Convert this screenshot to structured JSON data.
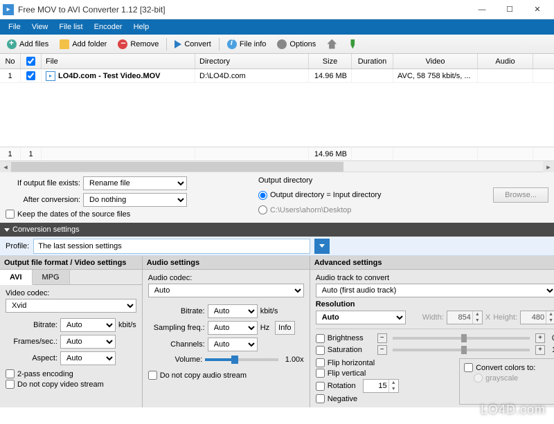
{
  "window": {
    "title": "Free MOV to AVI Converter 1.12  [32-bit]"
  },
  "menu": [
    "File",
    "View",
    "File list",
    "Encoder",
    "Help"
  ],
  "toolbar": {
    "add_files": "Add files",
    "add_folder": "Add folder",
    "remove": "Remove",
    "convert": "Convert",
    "file_info": "File info",
    "options": "Options"
  },
  "grid": {
    "headers": {
      "no": "No",
      "file": "File",
      "dir": "Directory",
      "size": "Size",
      "dur": "Duration",
      "video": "Video",
      "audio": "Audio"
    },
    "rows": [
      {
        "no": "1",
        "checked": true,
        "file": "LO4D.com - Test Video.MOV",
        "dir": "D:\\LO4D.com",
        "size": "14.96 MB",
        "dur": "",
        "video": "AVC, 58 758 kbit/s, ...",
        "audio": ""
      }
    ],
    "footer": {
      "idx": "1",
      "count": "1",
      "total_size": "14.96 MB"
    }
  },
  "output_opts": {
    "if_exists_label": "If output file exists:",
    "if_exists_value": "Rename file",
    "after_label": "After conversion:",
    "after_value": "Do nothing",
    "keep_dates": "Keep the dates of the source files",
    "outdir_label": "Output directory",
    "outdir_same": "Output directory = Input directory",
    "outdir_path": "C:\\Users\\ahorn\\Desktop",
    "browse": "Browse..."
  },
  "section_title": "Conversion settings",
  "profile": {
    "label": "Profile:",
    "value": "The last session settings"
  },
  "video_pane": {
    "title": "Output file format / Video settings",
    "tabs": [
      "AVI",
      "MPG"
    ],
    "codec_label": "Video codec:",
    "codec_value": "Xvid",
    "bitrate_label": "Bitrate:",
    "bitrate_value": "Auto",
    "bitrate_unit": "kbit/s",
    "fps_label": "Frames/sec.:",
    "fps_value": "Auto",
    "aspect_label": "Aspect:",
    "aspect_value": "Auto",
    "two_pass": "2-pass encoding",
    "no_copy_video": "Do not copy video stream"
  },
  "audio_pane": {
    "title": "Audio settings",
    "codec_label": "Audio codec:",
    "codec_value": "Auto",
    "bitrate_label": "Bitrate:",
    "bitrate_value": "Auto",
    "bitrate_unit": "kbit/s",
    "samp_label": "Sampling freq.:",
    "samp_value": "Auto",
    "samp_unit": "Hz",
    "chan_label": "Channels:",
    "chan_value": "Auto",
    "vol_label": "Volume:",
    "vol_value": "1.00x",
    "info_btn": "Info",
    "no_copy_audio": "Do not copy audio stream"
  },
  "adv_pane": {
    "title": "Advanced settings",
    "track_label": "Audio track to convert",
    "track_value": "Auto (first audio track)",
    "res_label": "Resolution",
    "res_value": "Auto",
    "width_label": "Width:",
    "width_value": "854",
    "height_label": "Height:",
    "height_value": "480",
    "brightness": "Brightness",
    "brightness_val": "0",
    "saturation": "Saturation",
    "saturation_val": "1",
    "flip_h": "Flip horizontal",
    "flip_v": "Flip vertical",
    "rotation": "Rotation",
    "rotation_value": "15",
    "negative": "Negative",
    "convert_colors": "Convert colors to:",
    "grayscale": "grayscale"
  },
  "watermark": "LO4D.com"
}
